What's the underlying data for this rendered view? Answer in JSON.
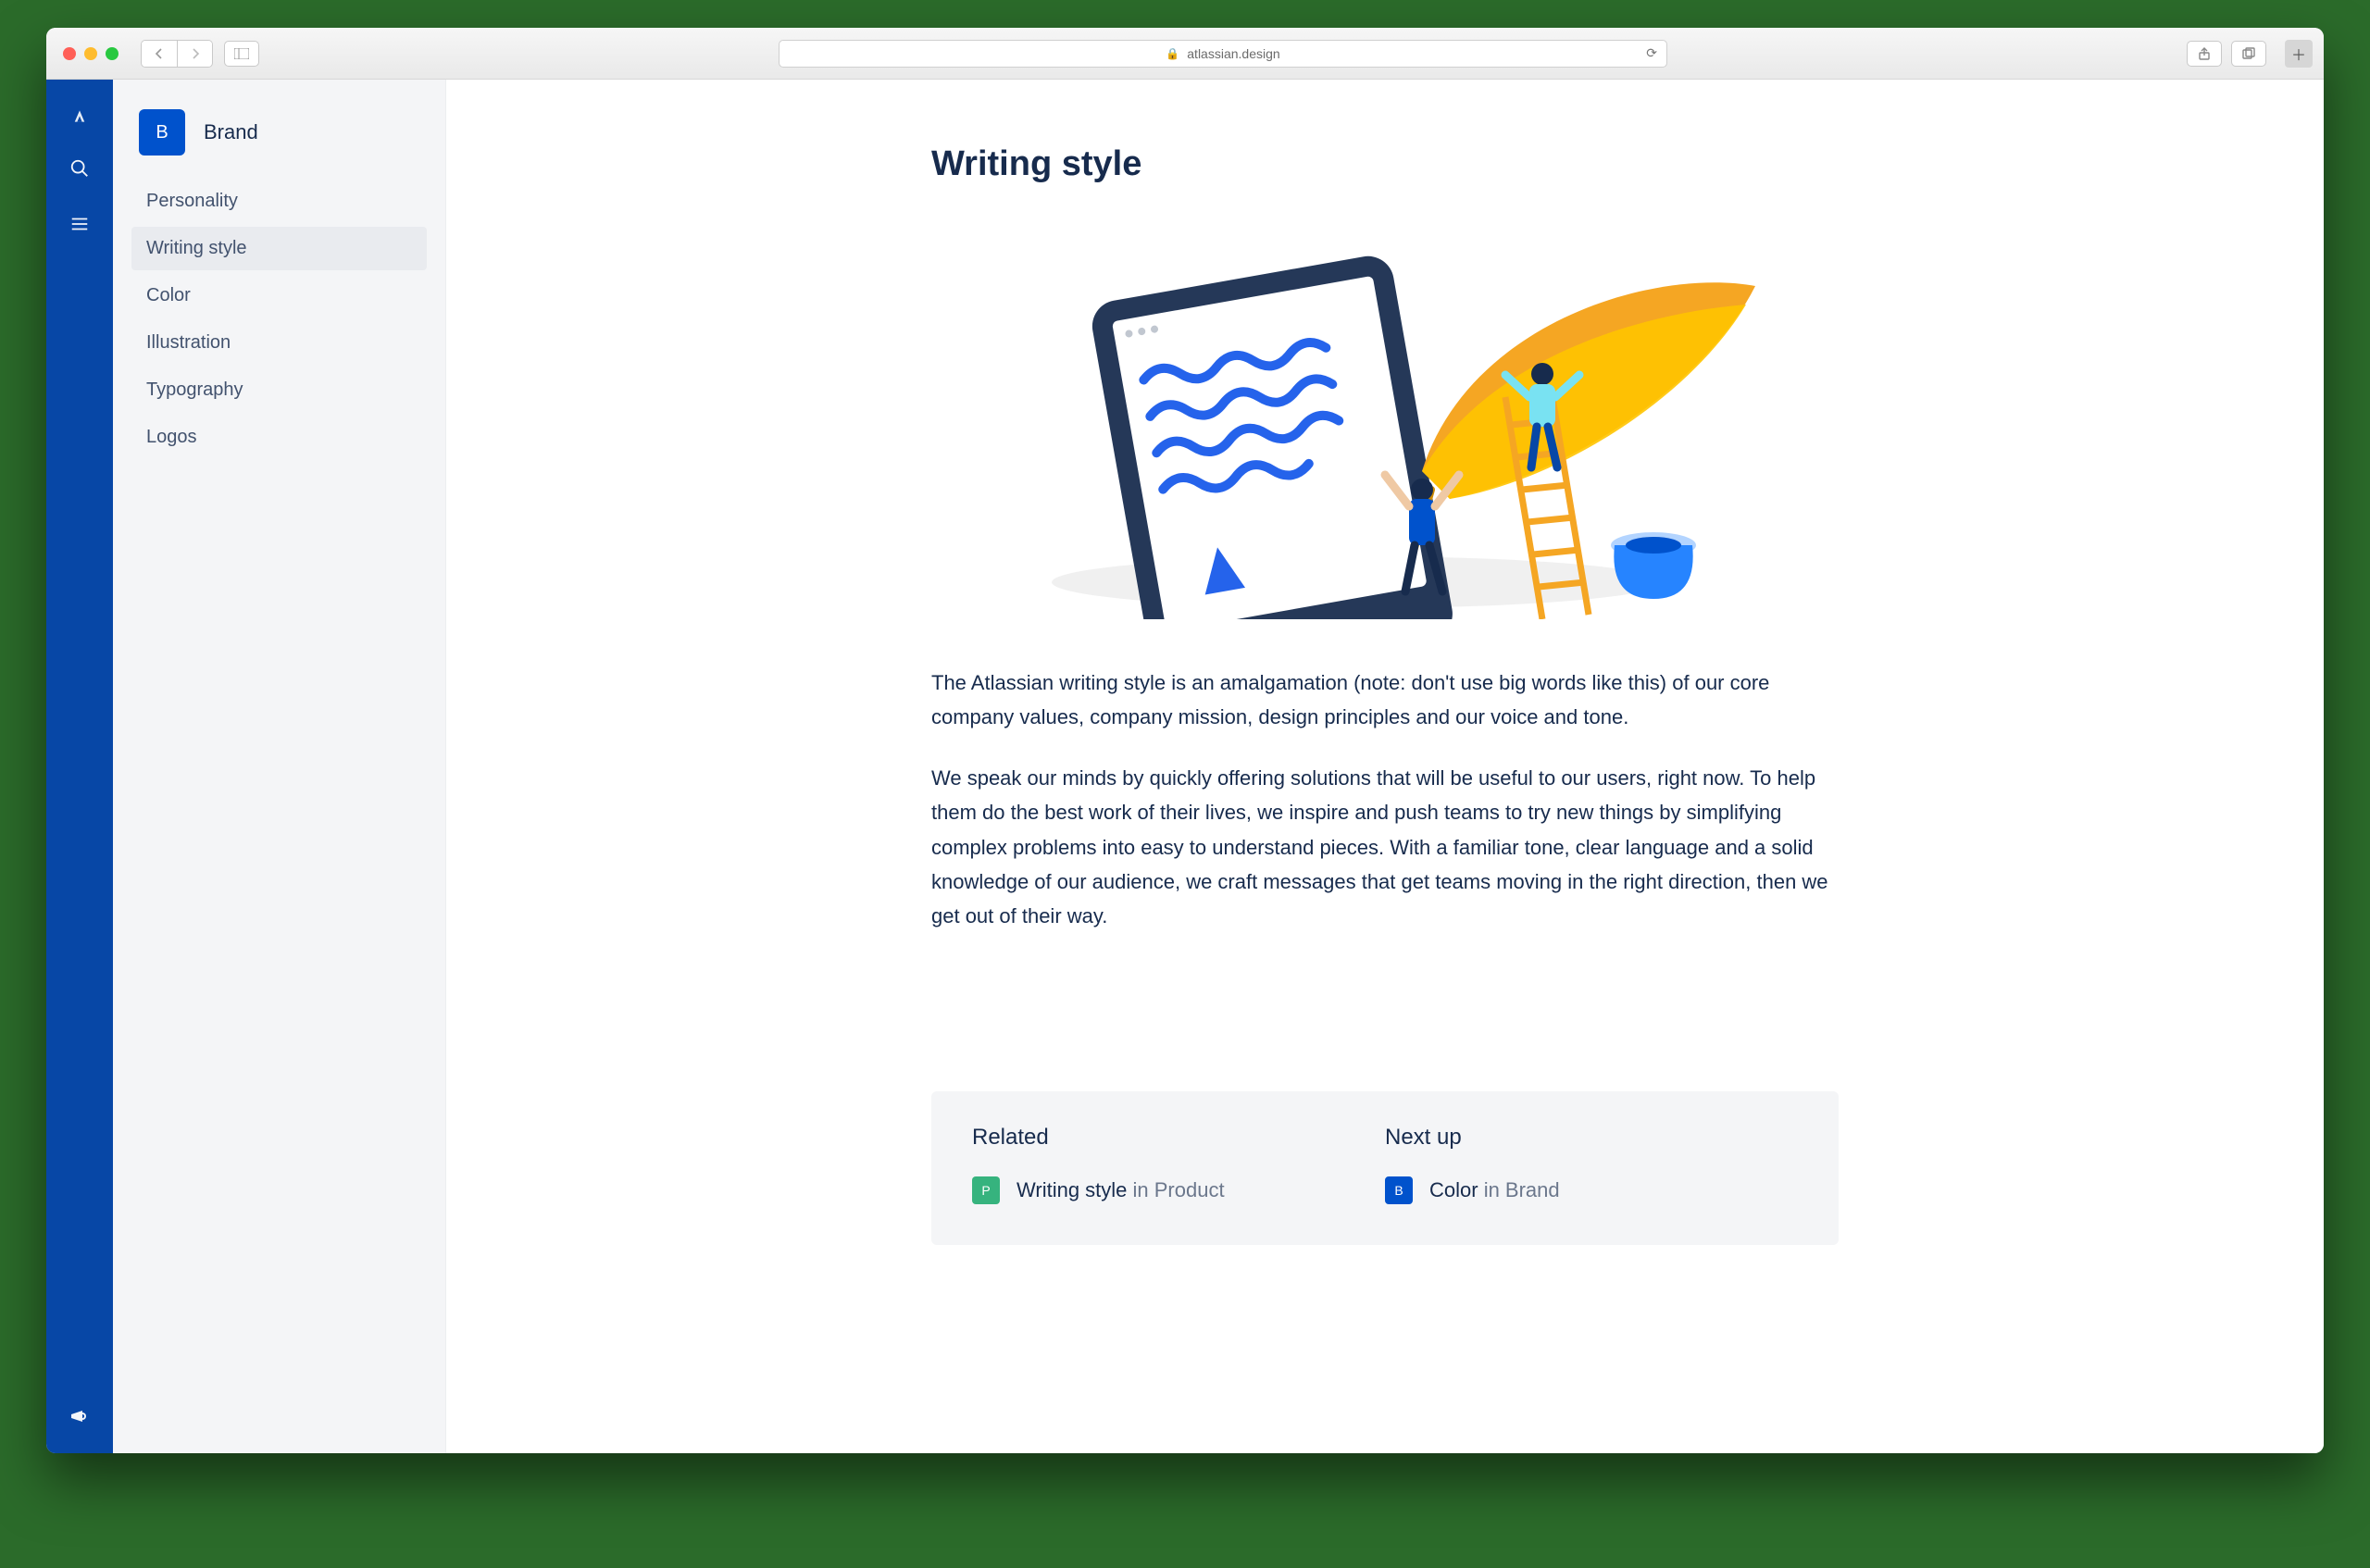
{
  "browser": {
    "url": "atlassian.design"
  },
  "rail": {
    "items": [
      "logo",
      "search",
      "menu"
    ],
    "bottom": "feedback"
  },
  "sidebar": {
    "badge_letter": "B",
    "title": "Brand",
    "items": [
      {
        "label": "Personality",
        "active": false
      },
      {
        "label": "Writing style",
        "active": true
      },
      {
        "label": "Color",
        "active": false
      },
      {
        "label": "Illustration",
        "active": false
      },
      {
        "label": "Typography",
        "active": false
      },
      {
        "label": "Logos",
        "active": false
      }
    ]
  },
  "article": {
    "title": "Writing style",
    "paragraphs": [
      "The Atlassian writing style is an amalgamation (note: don't use big words like this) of our core company values, company mission, design principles and our voice and tone.",
      "We speak our minds by quickly offering solutions that will be useful to our users, right now. To help them do the best work of their lives, we inspire and push teams to try new things by simplifying complex problems into easy to understand pieces. With a familiar tone, clear language and a solid knowledge of our audience, we craft messages that get teams moving in the right direction, then we get out of their way."
    ]
  },
  "footer": {
    "related": {
      "heading": "Related",
      "badge": "P",
      "link_text": "Writing style",
      "link_suffix": " in Product"
    },
    "next": {
      "heading": "Next up",
      "badge": "B",
      "link_text": "Color",
      "link_suffix": " in Brand"
    }
  }
}
